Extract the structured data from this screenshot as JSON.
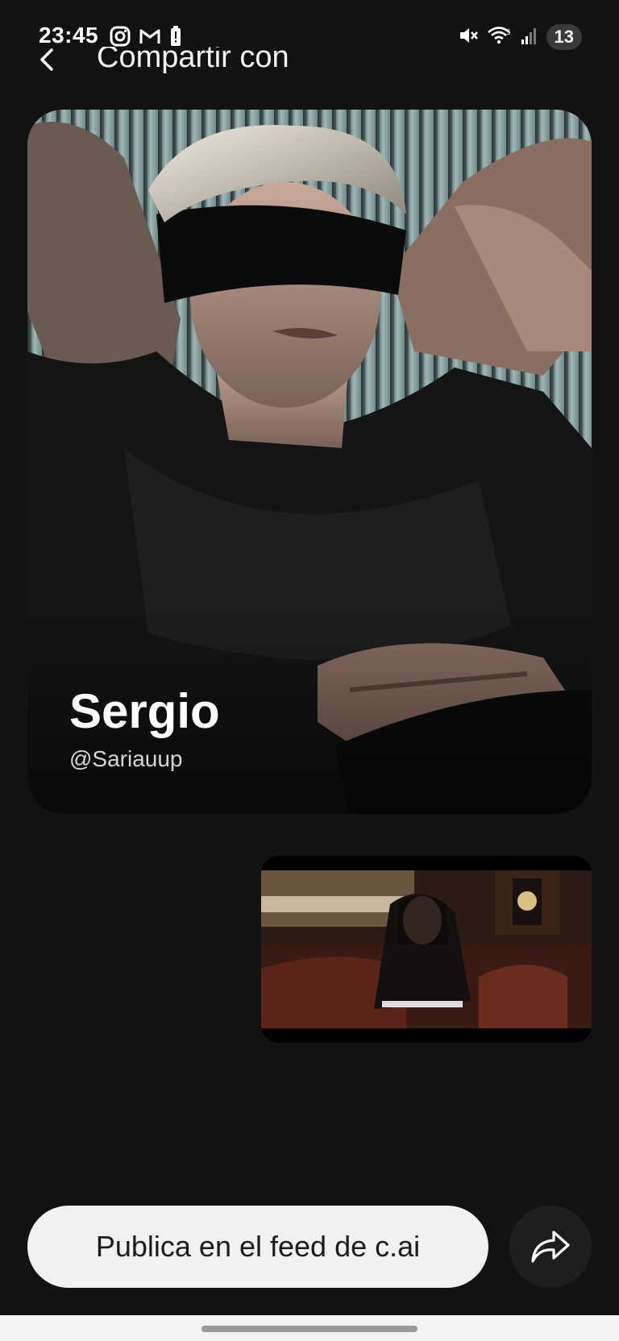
{
  "status_bar": {
    "time": "23:45",
    "left_icons": [
      "instagram-icon",
      "gmail-icon",
      "battery-alert-icon"
    ],
    "right_icons": [
      "mute-icon",
      "wifi-icon",
      "signal-icon"
    ],
    "notification_count": "13"
  },
  "header": {
    "title": "Compartir con",
    "back_icon": "chevron-left-icon"
  },
  "character_card": {
    "name": "Sergio",
    "handle": "@Sariauup",
    "image": "character-portrait"
  },
  "video": {
    "thumbnail": "video-thumbnail"
  },
  "actions": {
    "post_label": "Publica en el feed de c.ai",
    "share_icon": "share-icon"
  },
  "colors": {
    "background": "#121212",
    "post_button_bg": "#f1f1f1",
    "share_button_bg": "#1e1e1e",
    "badge_bg": "#3a3a3a"
  }
}
